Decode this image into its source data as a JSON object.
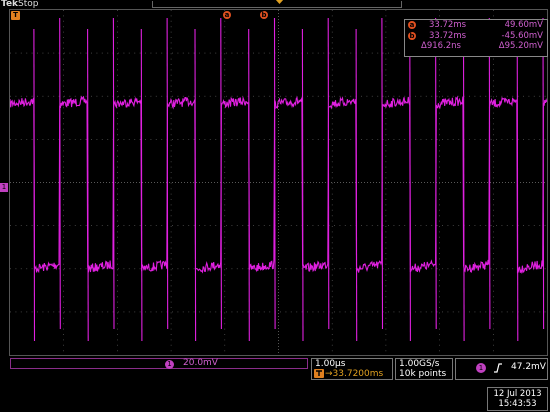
{
  "header": {
    "brand": "Tek",
    "run_state": "Stop"
  },
  "markers": {
    "trigger_label": "T",
    "cursor_a": "a",
    "cursor_b": "b",
    "ch_ground": "1"
  },
  "measurements": {
    "a_time": "33.72ms",
    "a_volt": "49.60mV",
    "b_time": "33.72ms",
    "b_volt": "-45.60mV",
    "delta_time": "Δ916.2ns",
    "delta_volt": "Δ95.20mV"
  },
  "channel": {
    "number": "1",
    "scale": "20.0mV",
    "color": "#e020e0"
  },
  "timebase": {
    "scale": "1.00µs",
    "position": "33.7200ms"
  },
  "acquisition": {
    "sample_rate": "1.00GS/s",
    "record_length": "10k points"
  },
  "trigger": {
    "source": "1",
    "slope_icon": "rising-edge-icon",
    "level": "47.2mV"
  },
  "datetime": {
    "date": "12 Jul  2013",
    "time": "15:43:53"
  },
  "colors": {
    "accent": "#e05020",
    "trace": "#e020e0",
    "grid": "#666666"
  }
}
